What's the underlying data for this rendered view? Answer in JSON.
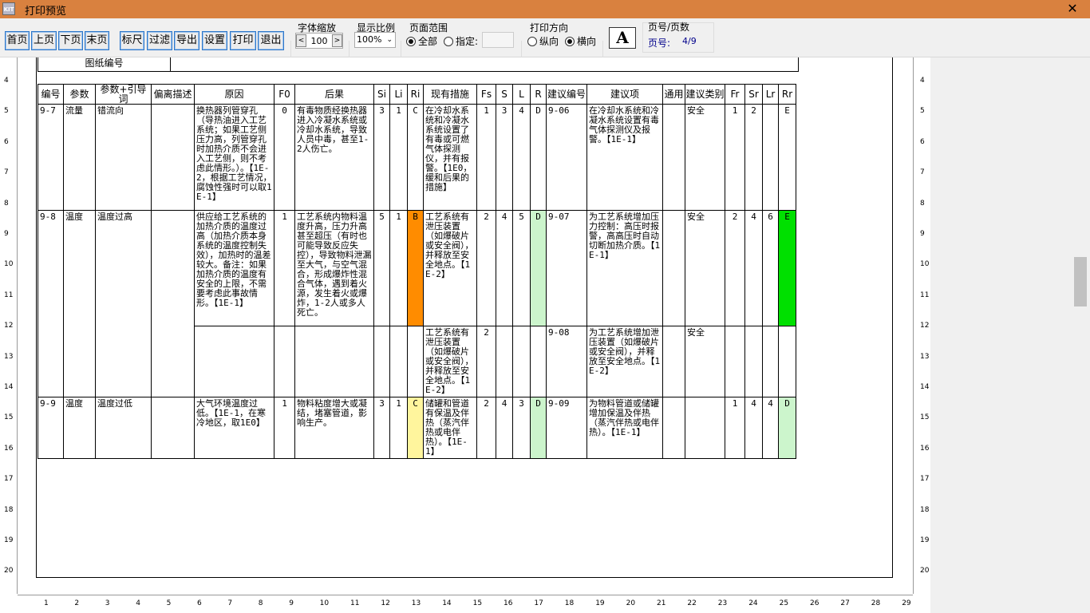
{
  "window": {
    "title": "打印预览",
    "icon": "app-icon",
    "close_glyph": "✕"
  },
  "toolbar": {
    "buttons": [
      "首页",
      "上页",
      "下页",
      "末页",
      "标尺",
      "过滤",
      "导出",
      "设置",
      "打印",
      "退出"
    ],
    "font_scale": {
      "label": "字体缩放",
      "value": "100",
      "dec": "<",
      "inc": ">"
    },
    "display_ratio": {
      "label": "显示比例",
      "value": "100%"
    },
    "page_range": {
      "label": "页面范围",
      "all": "全部",
      "specify": "指定:",
      "selected": "all"
    },
    "orientation": {
      "label": "打印方向",
      "portrait": "纵向",
      "landscape": "横向",
      "selected": "landscape"
    },
    "font_button": "A",
    "page_info": {
      "label": "页号/页数",
      "page_label": "页号:",
      "value": "4/9"
    }
  },
  "rulers": {
    "vertical": [
      "4",
      "5",
      "6",
      "7",
      "8",
      "9",
      "10",
      "11",
      "12",
      "13",
      "14",
      "15",
      "16",
      "17",
      "18",
      "19",
      "20"
    ],
    "horizontal": [
      "1",
      "2",
      "3",
      "4",
      "5",
      "6",
      "7",
      "8",
      "9",
      "10",
      "11",
      "12",
      "13",
      "14",
      "15",
      "16",
      "17",
      "18",
      "19",
      "20",
      "21",
      "22",
      "23",
      "24",
      "25",
      "26",
      "27",
      "28",
      "29"
    ]
  },
  "sheet": {
    "drawing_no_label": "图纸编号",
    "headers": [
      "编号",
      "参数",
      "参数+引导词",
      "偏离描述",
      "原因",
      "F0",
      "后果",
      "Si",
      "Li",
      "Ri",
      "现有措施",
      "Fs",
      "S",
      "L",
      "R",
      "建议编号",
      "建议项",
      "通用",
      "建议类别",
      "Fr",
      "Sr",
      "Lr",
      "Rr"
    ],
    "rows": {
      "r1": {
        "id": "9-7",
        "param": "流量",
        "guide": "错流向",
        "dev": "",
        "cause": "换热器列管穿孔（导热油进入工艺系统；如果工艺侧压力高，列管穿孔时加热介质不会进入工艺侧，则不考虑此情形。）。【1E-2，根据工艺情况，腐蚀性强时可以取1E-1】",
        "f0": "0",
        "cons": "有毒物质经换热器进入冷凝水系统或冷却水系统，导致人员中毒，甚至1-2人伤亡。",
        "si": "3",
        "li": "1",
        "ri": "C",
        "measure": "在冷却水系统和冷凝水系统设置了有毒或可燃气体探测仪，并有报警。【1E0，缓和后果的措施】",
        "fs": "1",
        "s": "3",
        "l": "4",
        "r": "D",
        "sug_no": "9-06",
        "sug": "在冷却水系统和冷凝水系统设置有毒气体探测仪及报警。【1E-1】",
        "common": "",
        "category": "安全",
        "fr": "1",
        "sr": "2",
        "lr": "",
        "rr": "E"
      },
      "r2": {
        "id": "9-8",
        "param": "温度",
        "guide": "温度过高",
        "dev": "",
        "cause": "供应给工艺系统的加热介质的温度过高（加热介质本身系统的温度控制失效），加热时的温差较大。备注：如果加热介质的温度有安全的上限，不需要考虑此事故情形。【1E-1】",
        "f0": "1",
        "cons": "工艺系统内物料温度升高，压力升高甚至超压（有时也可能导致反应失控），导致物料泄漏至大气，与空气混合，形成爆炸性混合气体，遇到着火源，发生着火或爆炸，1-2人或多人死亡。",
        "si": "5",
        "li": "1",
        "ri": "B",
        "measure": "工艺系统有泄压装置（如爆破片或安全阀），并释放至安全地点。【1E-2】",
        "fs": "2",
        "s": "4",
        "l": "5",
        "r": "D",
        "sug_no": "9-07",
        "sug": "为工艺系统增加压力控制：高压时报警，高高压时自动切断加热介质。【1E-1】",
        "common": "",
        "category": "安全",
        "fr": "2",
        "sr": "4",
        "lr": "6",
        "rr": "E"
      },
      "r2b": {
        "measure": "工艺系统有泄压装置（如爆破片或安全阀），并释放至安全地点。【1E-2】",
        "fs": "2",
        "sug_no": "9-08",
        "sug": "为工艺系统增加泄压装置（如爆破片或安全阀），并释放至安全地点。【1E-2】",
        "category": "安全"
      },
      "r3": {
        "id": "9-9",
        "param": "温度",
        "guide": "温度过低",
        "dev": "",
        "cause": "大气环境温度过低。【1E-1，在寒冷地区，取1E0】",
        "f0": "1",
        "cons": "物料粘度增大或凝结，堵塞管道，影响生产。",
        "si": "3",
        "li": "1",
        "ri": "C",
        "measure": "储罐和管道有保温及伴热（蒸汽伴热或电伴热）。【1E-1】",
        "fs": "2",
        "s": "4",
        "l": "3",
        "r": "D",
        "sug_no": "9-09",
        "sug": "为物料管道或储罐增加保温及伴热（蒸汽伴热或电伴热）。【1E-1】",
        "common": "",
        "category": "",
        "fr": "1",
        "sr": "4",
        "lr": "4",
        "rr": "D"
      }
    }
  },
  "colors": {
    "titlebar": "#d9813f",
    "risk_B": "#ff8c00",
    "risk_C": "#fff59d",
    "risk_D": "#ccf5cc",
    "risk_E": "#00e000"
  }
}
